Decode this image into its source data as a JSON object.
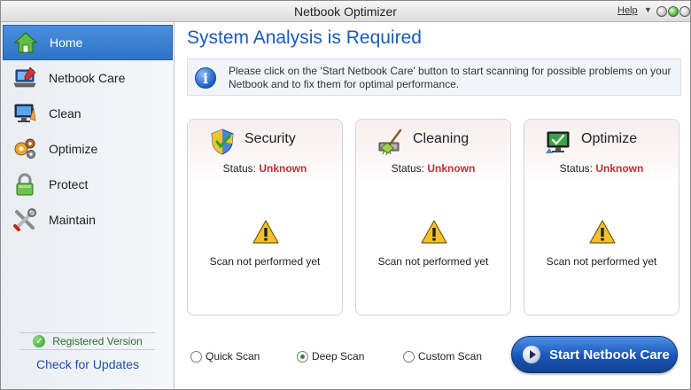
{
  "window": {
    "title": "Netbook Optimizer",
    "help_label": "Help",
    "help_arrow": "▼"
  },
  "sidebar": {
    "items": [
      {
        "label": "Home",
        "icon": "home-icon",
        "active": true
      },
      {
        "label": "Netbook Care",
        "icon": "netbook-care-icon",
        "active": false
      },
      {
        "label": "Clean",
        "icon": "clean-icon",
        "active": false
      },
      {
        "label": "Optimize",
        "icon": "optimize-icon",
        "active": false
      },
      {
        "label": "Protect",
        "icon": "lock-icon",
        "active": false
      },
      {
        "label": "Maintain",
        "icon": "tools-icon",
        "active": false
      }
    ],
    "registered_label": "Registered Version",
    "check_updates_label": "Check for Updates"
  },
  "main": {
    "title": "System Analysis is Required",
    "info_text": "Please click on the 'Start Netbook Care' button to start scanning for possible problems on your Netbook and to fix them for optimal performance."
  },
  "cards": [
    {
      "title": "Security",
      "status_label": "Status:",
      "status_value": "Unknown",
      "message": "Scan not performed yet",
      "icon": "shield-icon"
    },
    {
      "title": "Cleaning",
      "status_label": "Status:",
      "status_value": "Unknown",
      "message": "Scan not performed yet",
      "icon": "broom-icon"
    },
    {
      "title": "Optimize",
      "status_label": "Status:",
      "status_value": "Unknown",
      "message": "Scan not performed yet",
      "icon": "monitor-check-icon"
    }
  ],
  "scan_options": [
    {
      "label": "Quick Scan",
      "selected": false
    },
    {
      "label": "Deep Scan",
      "selected": true
    },
    {
      "label": "Custom Scan",
      "selected": false
    }
  ],
  "start_button_label": "Start Netbook Care",
  "colors": {
    "accent": "#2f73c8",
    "title_blue": "#1a5bb8",
    "status_red": "#c03030",
    "link_blue": "#1f4fb0"
  }
}
